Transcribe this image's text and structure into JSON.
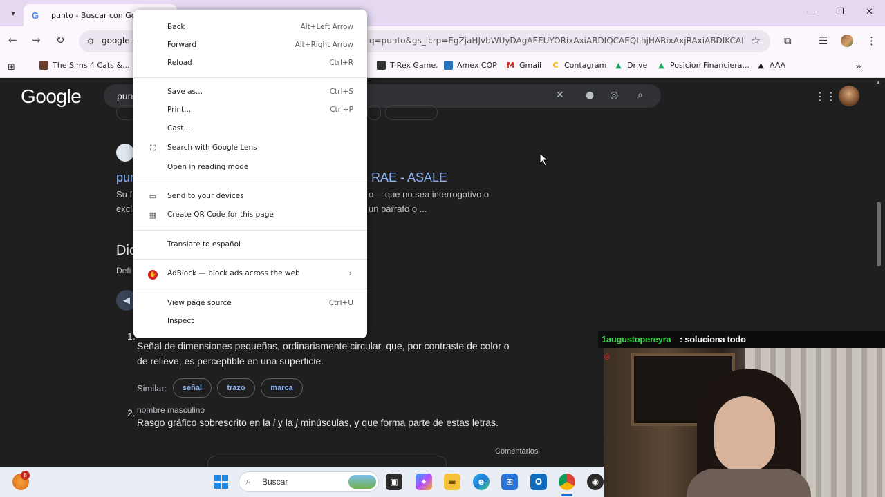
{
  "tab": {
    "title": "punto - Buscar con Google",
    "favicon": "G"
  },
  "window_controls": {
    "minimize": "—",
    "restore": "❐",
    "close": "✕"
  },
  "toolbar": {
    "back": "←",
    "forward": "→",
    "reload": "↻",
    "host": "google.c",
    "url_tail": "q=punto&gs_lcrp=EgZjaHJvbWUyDAgAEEUYORixAxiABDIQCAEQLhjHARixAxjRAxiABDIKCAI..."
  },
  "bookmarks": [
    {
      "label": "The Sims 4 Cats &...",
      "icon": "sims-icon",
      "color": "#6b3e2e"
    },
    {
      "label": "T-Rex Game.",
      "icon": "trex-icon",
      "color": "#333333"
    },
    {
      "label": "Amex COP",
      "icon": "amex-icon",
      "color": "#2671b9"
    },
    {
      "label": "Gmail",
      "icon": "gmail-icon",
      "color": "#d93025"
    },
    {
      "label": "Contagram",
      "icon": "contagram-icon",
      "color": "#f2b705"
    },
    {
      "label": "Drive",
      "icon": "drive-icon",
      "color": "#1fa463"
    },
    {
      "label": "Posicion Financiera...",
      "icon": "drive-icon",
      "color": "#1fa463"
    },
    {
      "label": "AAA",
      "icon": "aaa-icon",
      "color": "#222222"
    }
  ],
  "google": {
    "logo": "Google",
    "query": "punt",
    "result_title_left": "pun",
    "result_title_right": "RAE - ASALE",
    "snippet_l1_left": "Su f",
    "snippet_l1_right": "o —que no sea interrogativo o",
    "snippet_l2_left": "excl",
    "snippet_l2_right": "un párrafo o ...",
    "dict_heading": "Dic",
    "dict_def_label": "Defi",
    "def1_number": "1.",
    "def1_line1": "Señal de dimensiones pequeñas, ordinariamente circular, que, por contraste de color o",
    "def1_line2": "de relieve, es perceptible en una superficie.",
    "similar_label": "Similar:",
    "similar": [
      "señal",
      "trazo",
      "marca"
    ],
    "def2_number": "2.",
    "def2_pos": "nombre masculino",
    "def2_pre": "Rasgo gráfico sobrescrito en la ",
    "def2_i": "i",
    "def2_mid": " y la ",
    "def2_j": "j",
    "def2_post": " minúsculas, y que forma parte de estas letras.",
    "comments": "Comentarios"
  },
  "context_menu": [
    {
      "label": "Back",
      "shortcut": "Alt+Left Arrow"
    },
    {
      "label": "Forward",
      "shortcut": "Alt+Right Arrow"
    },
    {
      "label": "Reload",
      "shortcut": "Ctrl+R"
    },
    {
      "label": "Save as...",
      "shortcut": "Ctrl+S"
    },
    {
      "label": "Print...",
      "shortcut": "Ctrl+P"
    },
    {
      "label": "Cast...",
      "shortcut": ""
    },
    {
      "label": "Search with Google Lens",
      "shortcut": "",
      "icon": "google-lens-icon"
    },
    {
      "label": "Open in reading mode",
      "shortcut": ""
    },
    {
      "label": "Send to your devices",
      "shortcut": "",
      "icon": "devices-icon"
    },
    {
      "label": "Create QR Code for this page",
      "shortcut": "",
      "icon": "qr-code-icon"
    },
    {
      "label": "Translate to español",
      "shortcut": ""
    },
    {
      "label": "AdBlock — block ads across the web",
      "shortcut": "",
      "icon": "adblock-icon"
    },
    {
      "label": "View page source",
      "shortcut": "Ctrl+U"
    },
    {
      "label": "Inspect",
      "shortcut": ""
    }
  ],
  "stream_chat": {
    "user": "1augustopereyra",
    "message": ": soluciona todo"
  },
  "taskbar": {
    "notification_count": "8",
    "search_label": "Buscar",
    "apps": [
      "explorer-icon",
      "copilot-icon",
      "files-icon",
      "edge-icon",
      "store-icon",
      "outlook-icon",
      "chrome-icon",
      "obs-icon"
    ]
  },
  "colors": {
    "accent": "#8ab4f8",
    "chat_user": "#3ed64a",
    "adblock": "#d32020"
  }
}
